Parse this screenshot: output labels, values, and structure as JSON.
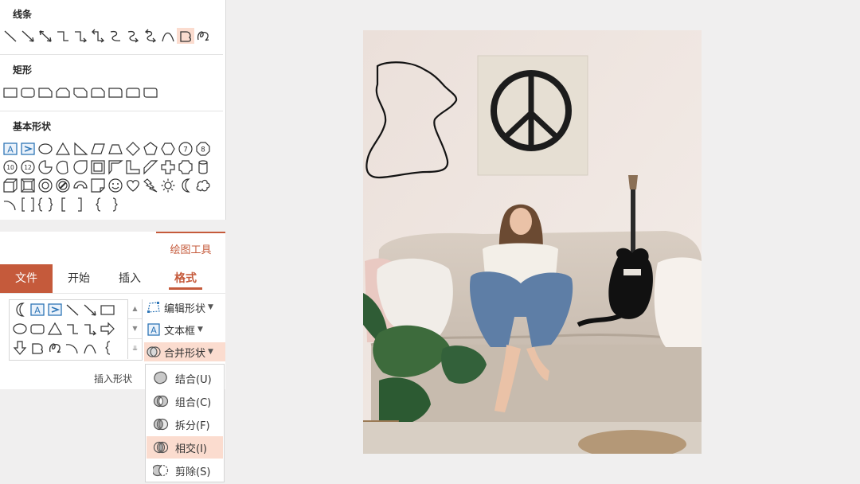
{
  "shape_gallery": {
    "sections": [
      {
        "title": "线条",
        "shapes": [
          "line",
          "arrow",
          "double-arrow",
          "elbow-connector",
          "elbow-arrow-connector",
          "elbow-double-arrow",
          "curved-connector",
          "curved-arrow-connector",
          "curved-double-arrow",
          "curve",
          "freeform",
          "scribble"
        ],
        "selected": "freeform"
      },
      {
        "title": "矩形",
        "shapes": [
          "rectangle",
          "rounded-rectangle",
          "snip-single-corner",
          "snip-same-side",
          "snip-diagonal",
          "snip-round",
          "round-single-corner",
          "round-same-side",
          "round-diagonal"
        ]
      },
      {
        "title": "基本形状",
        "shapes": [
          "text-box",
          "vertical-text-box",
          "oval",
          "triangle",
          "right-triangle",
          "parallelogram",
          "trapezoid",
          "diamond",
          "pentagon",
          "hexagon",
          "heptagon",
          "octagon",
          "decagon",
          "dodecagon",
          "pie",
          "chord",
          "teardrop",
          "frame",
          "half-frame",
          "l-shape",
          "diagonal-stripe",
          "cross",
          "plaque",
          "can",
          "cube",
          "bevel",
          "donut",
          "no-symbol",
          "block-arc",
          "folded-corner",
          "smiley-face",
          "heart",
          "lightning-bolt",
          "sun",
          "moon",
          "cloud",
          "arc",
          "double-bracket",
          "double-brace",
          "left-bracket",
          "right-bracket",
          "left-brace",
          "right-brace"
        ],
        "number_badges": [
          "7",
          "8",
          "10",
          "12"
        ]
      }
    ]
  },
  "ribbon": {
    "context_tab": "绘图工具",
    "tabs": [
      {
        "label": "文件",
        "style": "file"
      },
      {
        "label": "开始"
      },
      {
        "label": "插入"
      },
      {
        "label": "格式",
        "active": true
      }
    ],
    "insert_shapes": {
      "group_label": "插入形状",
      "commands": [
        {
          "label": "编辑形状",
          "icon": "edit-shape-icon",
          "dropdown": true
        },
        {
          "label": "文本框",
          "icon": "text-box-icon",
          "dropdown": true
        },
        {
          "label": "合并形状",
          "icon": "merge-shapes-icon",
          "dropdown": true,
          "highlighted": true
        }
      ]
    }
  },
  "merge_menu": {
    "items": [
      {
        "label": "结合(U)",
        "icon": "union-icon"
      },
      {
        "label": "组合(C)",
        "icon": "combine-icon"
      },
      {
        "label": "拆分(F)",
        "icon": "fragment-icon"
      },
      {
        "label": "相交(I)",
        "icon": "intersect-icon",
        "highlighted": true
      },
      {
        "label": "剪除(S)",
        "icon": "subtract-icon"
      }
    ]
  },
  "slide": {
    "image_alt": "girl-on-fluffy-sofa-with-guitar-and-peace-sign-poster",
    "freeform_shape": "drawn-freeform-outline"
  },
  "colors": {
    "accent": "#c55a3b",
    "highlight": "#fbdccf",
    "background": "#f0efef"
  }
}
